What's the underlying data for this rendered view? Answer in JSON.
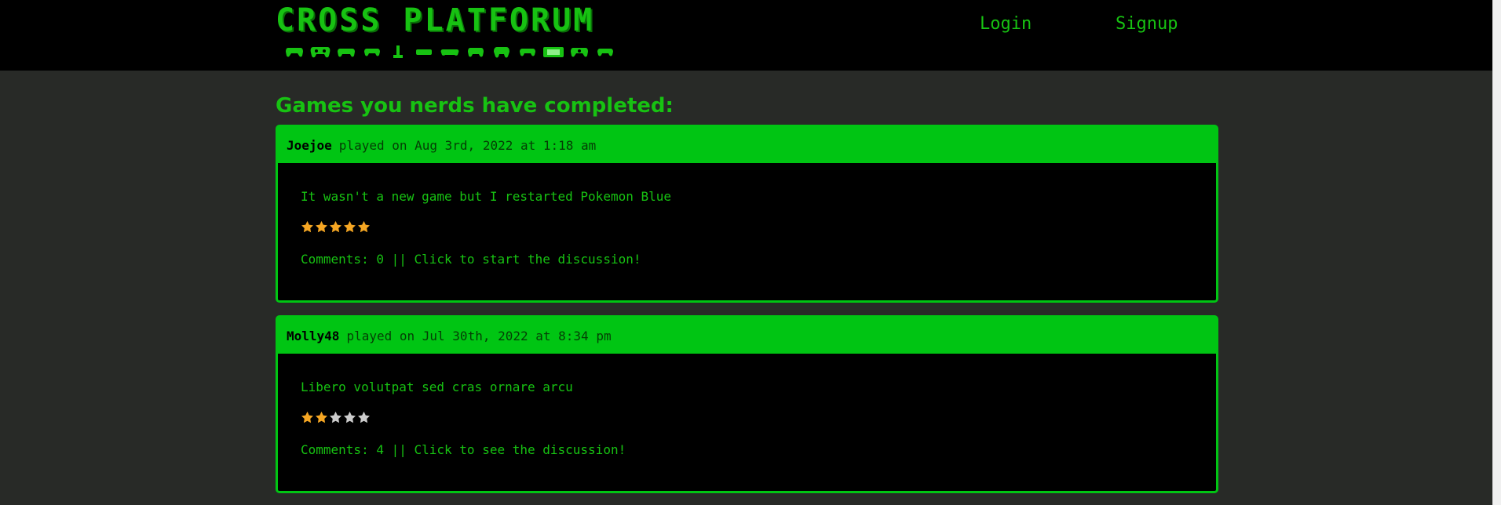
{
  "header": {
    "logo_text": "CROSS PLATFORUM",
    "controller_icons": [
      "gamepad-icon",
      "gamepad-icon",
      "gamepad-icon",
      "gamepad-icon",
      "joystick-icon",
      "handheld-icon",
      "gamepad-icon",
      "gamepad-icon",
      "gamepad-icon",
      "gamepad-icon",
      "handheld-icon",
      "gamepad-icon",
      "gamepad-icon"
    ],
    "nav": {
      "login": "Login",
      "signup": "Signup"
    }
  },
  "main": {
    "heading": "Games you nerds have completed:",
    "posts": [
      {
        "user": "Joejoe",
        "meta": "played on Aug 3rd, 2022 at 1:18 am",
        "text": "It wasn't a new game but I restarted Pokemon Blue",
        "rating": 5,
        "rating_max": 5,
        "comments": "Comments: 0 || Click to start the discussion!"
      },
      {
        "user": "Molly48",
        "meta": "played on Jul 30th, 2022 at 8:34 pm",
        "text": "Libero volutpat sed cras ornare arcu",
        "rating": 2,
        "rating_max": 5,
        "comments": "Comments: 4 || Click to see the discussion!"
      }
    ]
  },
  "colors": {
    "accent": "#17c212",
    "card_header": "#00c513",
    "background": "#282a27",
    "star_filled": "#f5a623",
    "star_empty": "#cccccc"
  }
}
